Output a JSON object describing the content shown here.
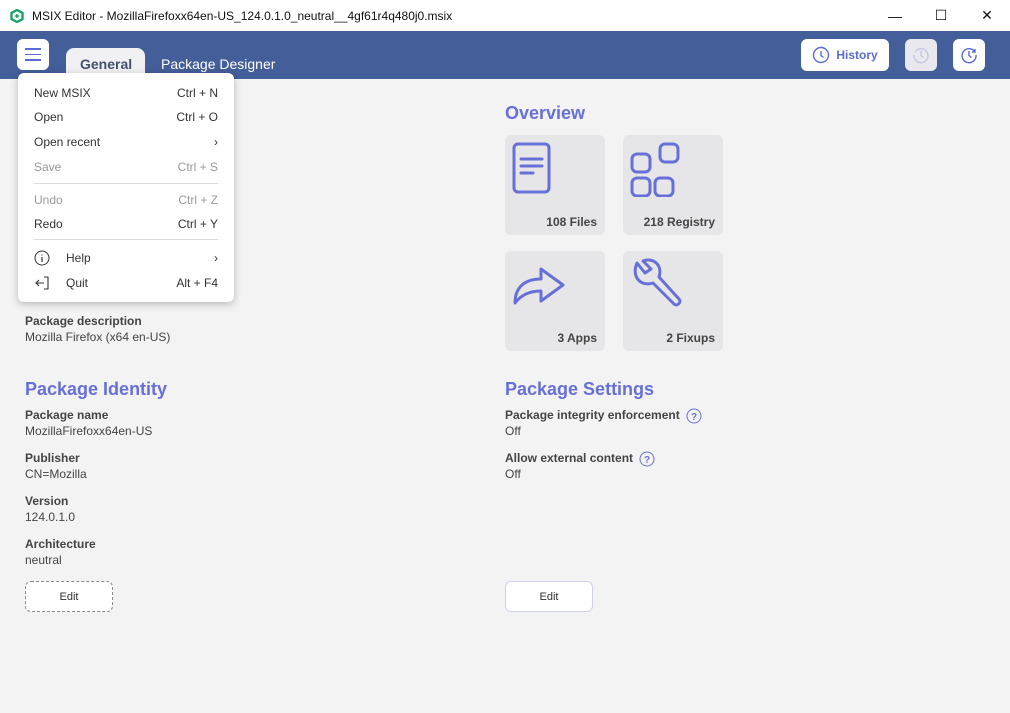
{
  "window": {
    "title": "MSIX Editor - MozillaFirefoxx64en-US_124.0.1.0_neutral__4gf61r4q480j0.msix",
    "minimize": "—",
    "maximize": "☐",
    "close": "✕"
  },
  "tabs": [
    {
      "label": "General",
      "active": true
    },
    {
      "label": "Package Designer",
      "active": false
    }
  ],
  "toolbar": {
    "history_label": "History"
  },
  "menu": {
    "items": [
      {
        "label": "New MSIX",
        "shortcut": "Ctrl + N"
      },
      {
        "label": "Open",
        "shortcut": "Ctrl + O"
      },
      {
        "label": "Open recent",
        "shortcut": "›"
      },
      {
        "label": "Save",
        "shortcut": "Ctrl + S",
        "disabled": true
      },
      {
        "label": "Undo",
        "shortcut": "Ctrl + Z",
        "disabled": true
      },
      {
        "label": "Redo",
        "shortcut": "Ctrl + Y"
      },
      {
        "label": "Help",
        "shortcut": "›",
        "icon": "info-icon"
      },
      {
        "label": "Quit",
        "shortcut": "Alt + F4",
        "icon": "exit-icon"
      }
    ]
  },
  "general": {
    "description_label": "Package description",
    "description": "Mozilla Firefox (x64 en-US)"
  },
  "identity": {
    "heading": "Package Identity",
    "fields": [
      {
        "label": "Package name",
        "value": "MozillaFirefoxx64en-US"
      },
      {
        "label": "Publisher",
        "value": "CN=Mozilla"
      },
      {
        "label": "Version",
        "value": "124.0.1.0"
      },
      {
        "label": "Architecture",
        "value": "neutral"
      }
    ],
    "edit_label": "Edit"
  },
  "overview": {
    "heading": "Overview",
    "tiles": [
      {
        "label": "108 Files",
        "icon": "document-icon"
      },
      {
        "label": "218 Registry",
        "icon": "registry-icon"
      },
      {
        "label": "3 Apps",
        "icon": "share-arrow-icon"
      },
      {
        "label": "2 Fixups",
        "icon": "wrench-icon"
      }
    ]
  },
  "settings": {
    "heading": "Package Settings",
    "fields": [
      {
        "label": "Package integrity enforcement",
        "value": "Off"
      },
      {
        "label": "Allow external content",
        "value": "Off"
      }
    ],
    "edit_label": "Edit"
  },
  "colors": {
    "appbar": "#445e99",
    "accent": "#6670d8",
    "background": "#f3f3f3"
  }
}
